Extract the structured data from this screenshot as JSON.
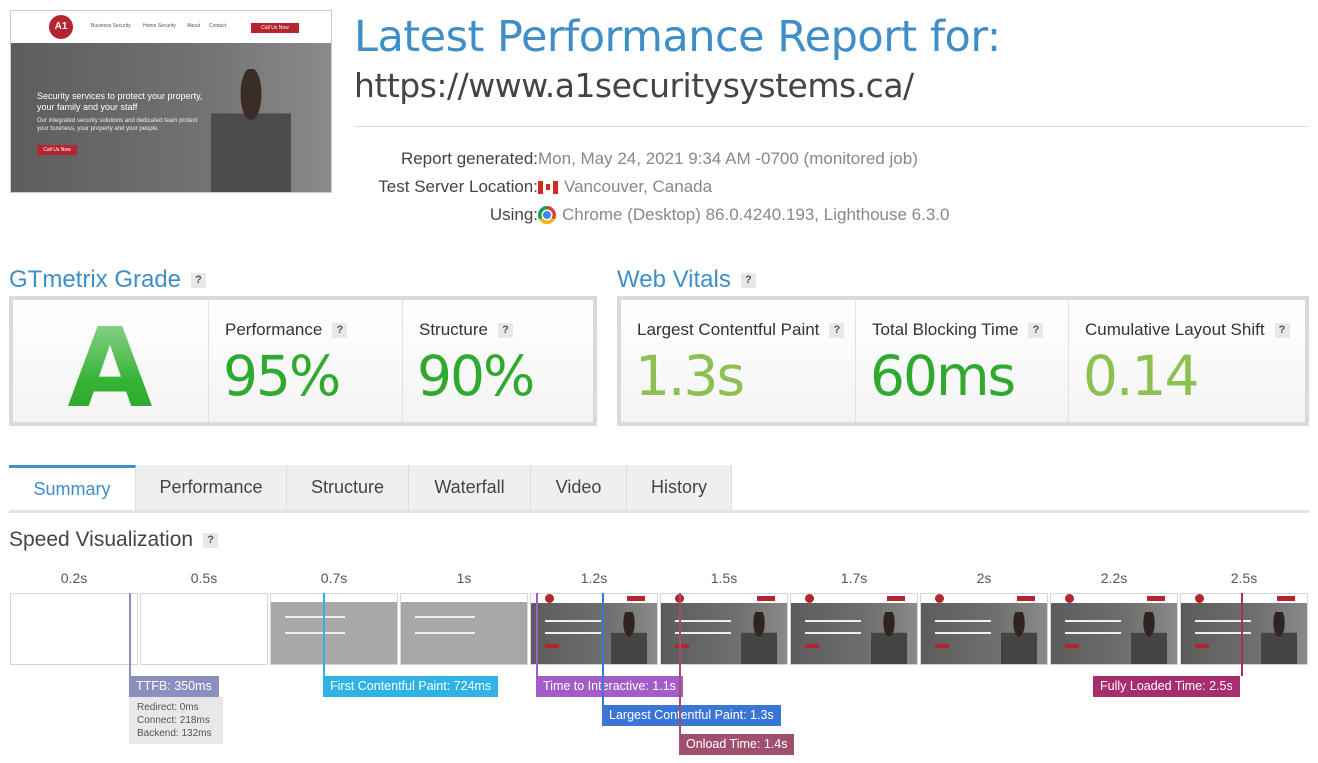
{
  "thumbnail": {
    "logo_text": "A1",
    "nav": [
      "Business Security",
      "Home Security",
      "About",
      "Contact"
    ],
    "cta": "Call Us Now",
    "headline": "Security services to protect your property, your family and your staff",
    "subtext": "Our integrated security solutions and dedicated team protect your business, your property and your people.",
    "button": "Call Us Now"
  },
  "report": {
    "title": "Latest Performance Report for:",
    "url": "https://www.a1securitysystems.ca/",
    "generated_label": "Report generated:",
    "generated_value": "Mon, May 24, 2021 9:34 AM -0700 (monitored job)",
    "location_label": "Test Server Location:",
    "location_value": "Vancouver, Canada",
    "using_label": "Using:",
    "using_value": "Chrome (Desktop) 86.0.4240.193, Lighthouse 6.3.0",
    "flag_icon": "canada-flag-icon",
    "browser_icon": "chrome-icon"
  },
  "grade": {
    "heading": "GTmetrix Grade",
    "help": "?",
    "letter": "A",
    "performance_label": "Performance",
    "performance_value": "95%",
    "structure_label": "Structure",
    "structure_value": "90%"
  },
  "vitals": {
    "heading": "Web Vitals",
    "help": "?",
    "lcp_label": "Largest Contentful Paint",
    "lcp_value": "1.3s",
    "tbt_label": "Total Blocking Time",
    "tbt_value": "60ms",
    "cls_label": "Cumulative Layout Shift",
    "cls_value": "0.14"
  },
  "tabs": [
    "Summary",
    "Performance",
    "Structure",
    "Waterfall",
    "Video",
    "History"
  ],
  "speed": {
    "heading": "Speed Visualization",
    "help": "?",
    "ticks": [
      "0.2s",
      "0.5s",
      "0.7s",
      "1s",
      "1.2s",
      "1.5s",
      "1.7s",
      "2s",
      "2.2s",
      "2.5s"
    ],
    "frame_states": [
      "blank",
      "blank",
      "partial",
      "partial",
      "full",
      "full",
      "full",
      "full",
      "full",
      "full"
    ],
    "markers": {
      "ttfb": "TTFB: 350ms",
      "fcp": "First Contentful Paint: 724ms",
      "tti": "Time to Interactive: 1.1s",
      "lcp": "Largest Contentful Paint: 1.3s",
      "onload": "Onload Time: 1.4s",
      "fully_loaded": "Fully Loaded Time: 2.5s"
    },
    "ttfb_detail": {
      "redirect": "Redirect: 0ms",
      "connect": "Connect: 218ms",
      "backend": "Backend: 132ms"
    }
  },
  "colors": {
    "accent": "#3d8ec9",
    "good_green": "#2faa2f",
    "lightgreen": "#8cc152",
    "ttfb": "#8a8fbf",
    "fcp": "#2fb3e6",
    "tti": "#a35dc9",
    "lcp": "#3b76d6",
    "onload": "#a0506e",
    "fully_loaded": "#a82d6c"
  }
}
